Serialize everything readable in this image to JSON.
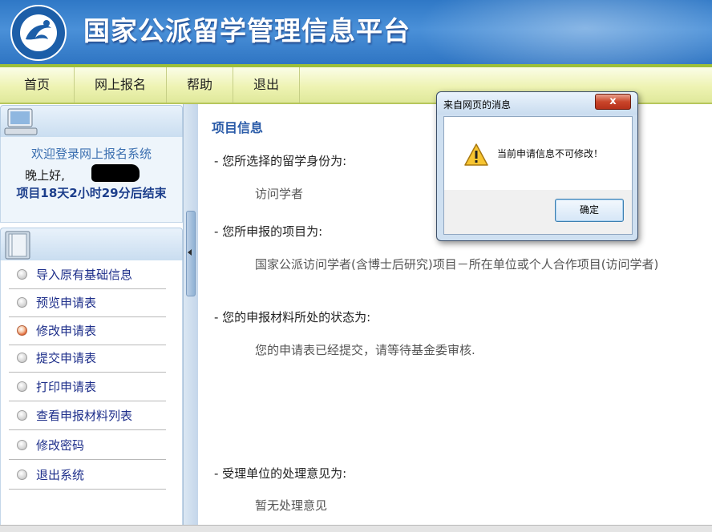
{
  "header": {
    "title": "国家公派留学管理信息平台"
  },
  "nav": {
    "items": [
      "首页",
      "网上报名",
      "帮助",
      "退出"
    ]
  },
  "sidebar": {
    "welcome": "欢迎登录网上报名系统",
    "greeting": "晚上好,",
    "countdown": "项目18天2小时29分后结束",
    "menu": [
      {
        "label": "导入原有基础信息",
        "active": false
      },
      {
        "label": "预览申请表",
        "active": false
      },
      {
        "label": "修改申请表",
        "active": true
      },
      {
        "label": "提交申请表",
        "active": false
      },
      {
        "label": "打印申请表",
        "active": false
      },
      {
        "label": "查看申报材料列表",
        "active": false
      },
      {
        "label": "修改密码",
        "active": false
      },
      {
        "label": "退出系统",
        "active": false
      }
    ]
  },
  "content": {
    "title": "项目信息",
    "q1": "- 您所选择的留学身份为:",
    "a1": "访问学者",
    "q2": "- 您所申报的项目为:",
    "a2": "国家公派访问学者(含博士后研究)项目－所在单位或个人合作项目(访问学者)",
    "q3": "- 您的申报材料所处的状态为:",
    "a3": "您的申请表已经提交，请等待基金委审核.",
    "q4": "- 受理单位的处理意见为:",
    "a4": "暂无处理意见"
  },
  "dialog": {
    "title": "来自网页的消息",
    "close": "x",
    "message": "当前申请信息不可修改！",
    "ok": "确定"
  }
}
